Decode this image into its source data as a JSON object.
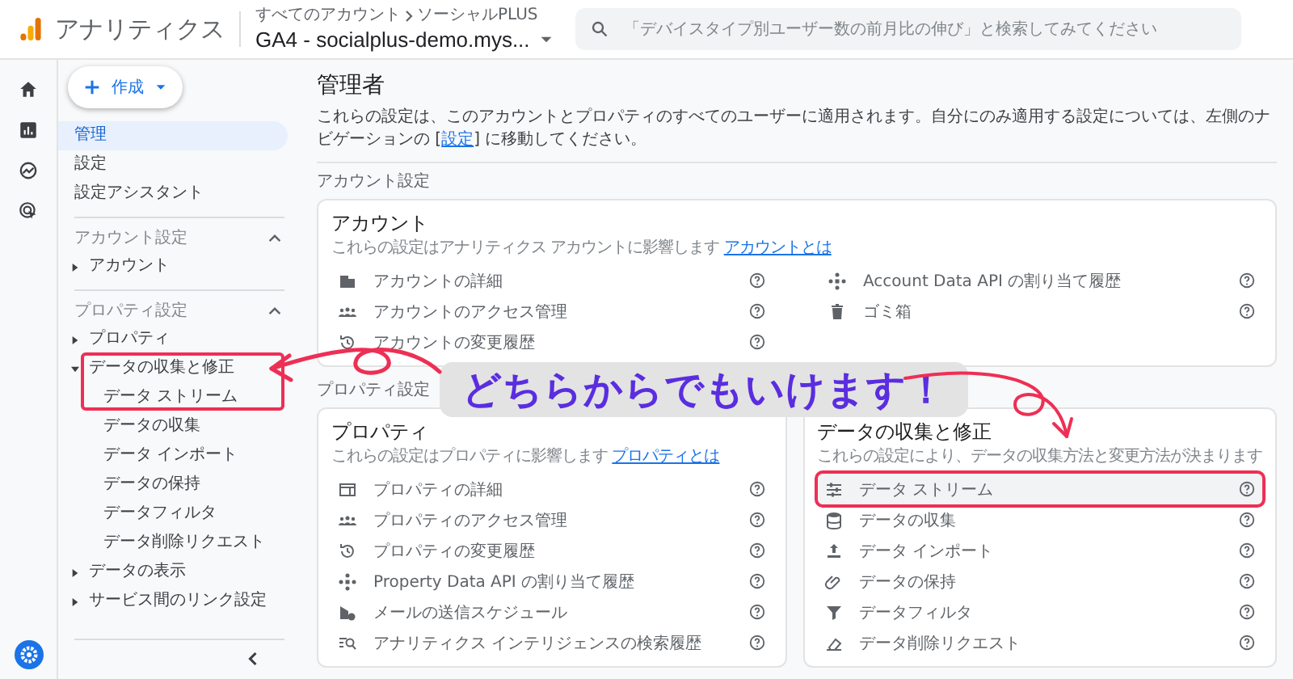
{
  "header": {
    "app_name": "アナリティクス",
    "breadcrumb": [
      "すべてのアカウント",
      "ソーシャルPLUS"
    ],
    "property": "GA4 - socialplus-demo.mys...",
    "search": {
      "placeholder": "「デバイスタイプ別ユーザー数の前月比の伸び」と検索してみてください"
    }
  },
  "create_button": {
    "label": "作成"
  },
  "sidebar": {
    "items": [
      {
        "label": "管理",
        "selected": true
      },
      {
        "label": "設定",
        "selected": false
      },
      {
        "label": "設定アシスタント",
        "selected": false
      }
    ],
    "sections": [
      {
        "title": "アカウント設定",
        "expanded": true,
        "items": [
          {
            "label": "アカウント",
            "expanded": false,
            "highlighted": false
          }
        ]
      },
      {
        "title": "プロパティ設定",
        "expanded": true,
        "items": [
          {
            "label": "プロパティ",
            "expanded": false,
            "highlighted": false
          },
          {
            "label": "データの収集と修正",
            "expanded": true,
            "highlighted": true,
            "children": [
              {
                "label": "データ ストリーム",
                "selected": false
              },
              {
                "label": "データの収集",
                "selected": false
              },
              {
                "label": "データ インポート",
                "selected": false
              },
              {
                "label": "データの保持",
                "selected": false
              },
              {
                "label": "データフィルタ",
                "selected": false
              },
              {
                "label": "データ削除リクエスト",
                "selected": false
              }
            ]
          },
          {
            "label": "データの表示",
            "expanded": false,
            "highlighted": false
          },
          {
            "label": "サービス間のリンク設定",
            "expanded": false,
            "highlighted": false
          }
        ]
      }
    ]
  },
  "main": {
    "title": "管理者",
    "description": {
      "before": "これらの設定は、このアカウントとプロパティのすべてのユーザーに適用されます。自分にのみ適用する設定については、左側のナビゲーションの [",
      "link": "設定",
      "after": "] に移動してください。"
    },
    "account_section": {
      "label": "アカウント設定",
      "card": {
        "title": "アカウント",
        "description": "これらの設定はアナリティクス アカウントに影響します",
        "link": "アカウントとは",
        "columns": [
          [
            {
              "label": "アカウントの詳細",
              "highlighted": false
            },
            {
              "label": "アカウントのアクセス管理",
              "highlighted": false
            },
            {
              "label": "アカウントの変更履歴",
              "highlighted": false
            }
          ],
          [
            {
              "label": "Account Data API の割り当て履歴",
              "highlighted": false
            },
            {
              "label": "ゴミ箱",
              "highlighted": false
            }
          ]
        ]
      }
    },
    "property_section": {
      "label": "プロパティ設定",
      "cards": [
        {
          "title": "プロパティ",
          "description": "これらの設定はプロパティに影響します",
          "link": "プロパティとは",
          "columns": [
            [
              {
                "label": "プロパティの詳細",
                "highlighted": false
              },
              {
                "label": "プロパティのアクセス管理",
                "highlighted": false
              },
              {
                "label": "プロパティの変更履歴",
                "highlighted": false
              },
              {
                "label": "Property Data API の割り当て履歴",
                "highlighted": false
              },
              {
                "label": "メールの送信スケジュール",
                "highlighted": false
              },
              {
                "label": "アナリティクス インテリジェンスの検索履歴",
                "highlighted": false
              }
            ]
          ]
        },
        {
          "title": "データの収集と修正",
          "description": "これらの設定により、データの収集方法と変更方法が決まります",
          "columns": [
            [
              {
                "label": "データ ストリーム",
                "highlighted": true
              },
              {
                "label": "データの収集",
                "highlighted": false
              },
              {
                "label": "データ インポート",
                "highlighted": false
              },
              {
                "label": "データの保持",
                "highlighted": false
              },
              {
                "label": "データフィルタ",
                "highlighted": false
              },
              {
                "label": "データ削除リクエスト",
                "highlighted": false
              }
            ]
          ]
        }
      ]
    }
  },
  "callout": "どちらからでもいけます！"
}
